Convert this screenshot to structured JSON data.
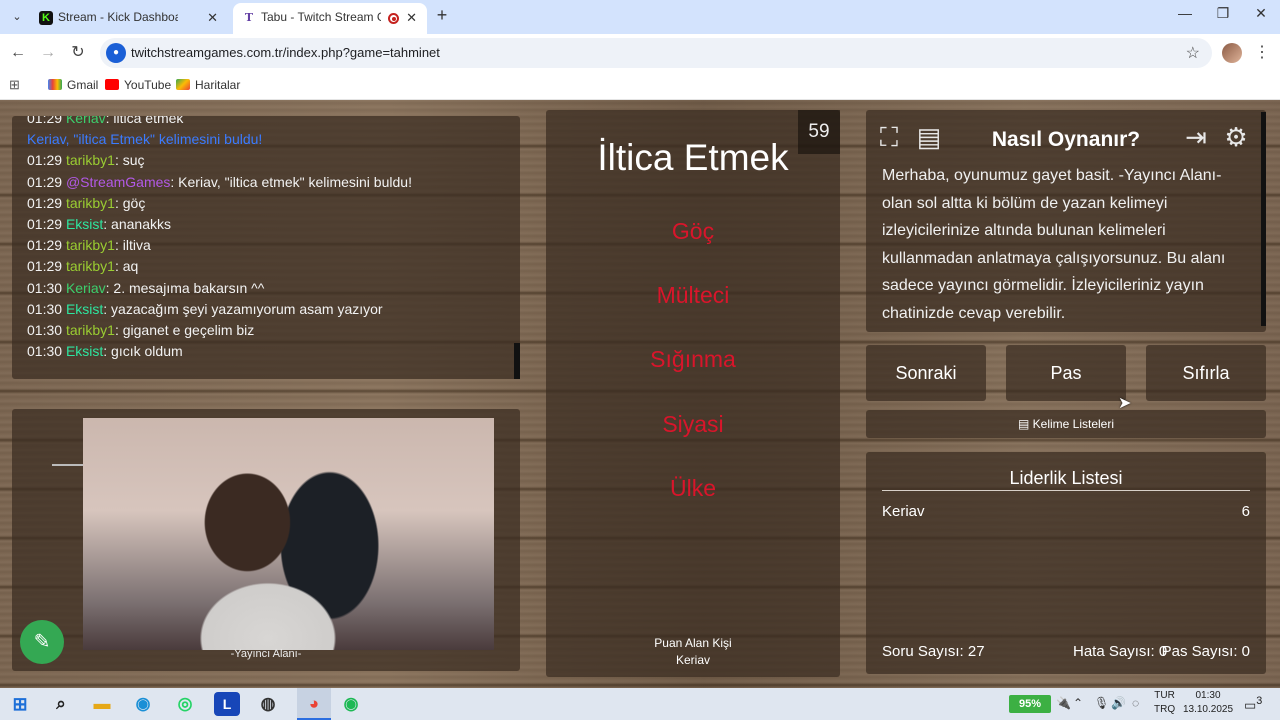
{
  "browser": {
    "tabs": [
      {
        "title": "Stream - Kick Dashboard",
        "favicon": "K"
      },
      {
        "title": "Tabu - Twitch Stream Game",
        "favicon": "T"
      }
    ],
    "url": "twitchstreamgames.com.tr/index.php?game=tahminet",
    "bookmarks": [
      "Gmail",
      "YouTube",
      "Haritalar"
    ]
  },
  "chat": {
    "messages": [
      {
        "time": "01:29",
        "user": "Keriav",
        "user_color": "#3ccf6d",
        "text": ": iltica etmek",
        "text_color": "#f2f2f2"
      },
      {
        "time": "",
        "user": "Keriav, \"iltica Etmek\"",
        "user_color": "#3b7bff",
        "text": " kelimesini buldu!",
        "text_color": "#3b7bff"
      },
      {
        "time": "01:29",
        "user": "tarikby1",
        "user_color": "#9acd32",
        "text": ": suç",
        "text_color": "#f2f2f2"
      },
      {
        "time": "01:29",
        "user": "@StreamGames",
        "user_color": "#b259e6",
        "text": ": Keriav, \"iltica etmek\" kelimesini buldu!",
        "text_color": "#f2f2f2"
      },
      {
        "time": "01:29",
        "user": "tarikby1",
        "user_color": "#9acd32",
        "text": ": göç",
        "text_color": "#f2f2f2"
      },
      {
        "time": "01:29",
        "user": "Eksist",
        "user_color": "#2ee6a0",
        "text": ": ananakks",
        "text_color": "#f2f2f2"
      },
      {
        "time": "01:29",
        "user": "tarikby1",
        "user_color": "#9acd32",
        "text": ": iltiva",
        "text_color": "#f2f2f2"
      },
      {
        "time": "01:29",
        "user": "tarikby1",
        "user_color": "#9acd32",
        "text": ": aq",
        "text_color": "#f2f2f2"
      },
      {
        "time": "01:30",
        "user": "Keriav",
        "user_color": "#3ccf6d",
        "text": ": 2. mesajıma bakarsın ^^",
        "text_color": "#f2f2f2"
      },
      {
        "time": "01:30",
        "user": "Eksist",
        "user_color": "#2ee6a0",
        "text": ": yazacağım şeyi yazamıyorum asam yazıyor",
        "text_color": "#f2f2f2"
      },
      {
        "time": "01:30",
        "user": "tarikby1",
        "user_color": "#9acd32",
        "text": ": giganet e geçelim biz",
        "text_color": "#f2f2f2"
      },
      {
        "time": "01:30",
        "user": "Eksist",
        "user_color": "#2ee6a0",
        "text": ": gıcık oldum",
        "text_color": "#f2f2f2"
      }
    ]
  },
  "camera": {
    "label": "-Yayıncı Alanı-"
  },
  "game": {
    "timer": "59",
    "word": "İltica Etmek",
    "taboo_words": [
      "Göç",
      "Mülteci",
      "Sığınma",
      "Siyasi",
      "Ülke"
    ],
    "scorer_label": "Puan Alan Kişi",
    "scorer_name": "Keriav"
  },
  "howto": {
    "title": "Nasıl Oynanır?",
    "body": "Merhaba, oyunumuz gayet basit. -Yayıncı Alanı- olan sol altta ki bölüm de yazan kelimeyi izleyicilerinize altında bulunan kelimeleri kullanmadan anlatmaya çalışıyorsunuz. Bu alanı sadece yayıncı görmelidir. İzleyicileriniz yayın chatinizde cevap verebilir."
  },
  "controls": {
    "next": "Sonraki",
    "pass": "Pas",
    "reset": "Sıfırla",
    "word_lists": "Kelime Listeleri"
  },
  "leaderboard": {
    "title": "Liderlik Listesi",
    "rows": [
      {
        "name": "Keriav",
        "score": "6"
      }
    ],
    "questions": "Soru Sayısı: 27",
    "errors": "Hata Sayısı: 0",
    "passes": "Pas Sayısı: 0"
  },
  "taskbar": {
    "battery": "95%",
    "language": "TUR",
    "layout": "TRQ",
    "time": "01:30",
    "date": "13.10.2025",
    "notifications": "3"
  },
  "colors": {
    "taboo": "#d9152b",
    "accent": "#1a5fd6"
  }
}
